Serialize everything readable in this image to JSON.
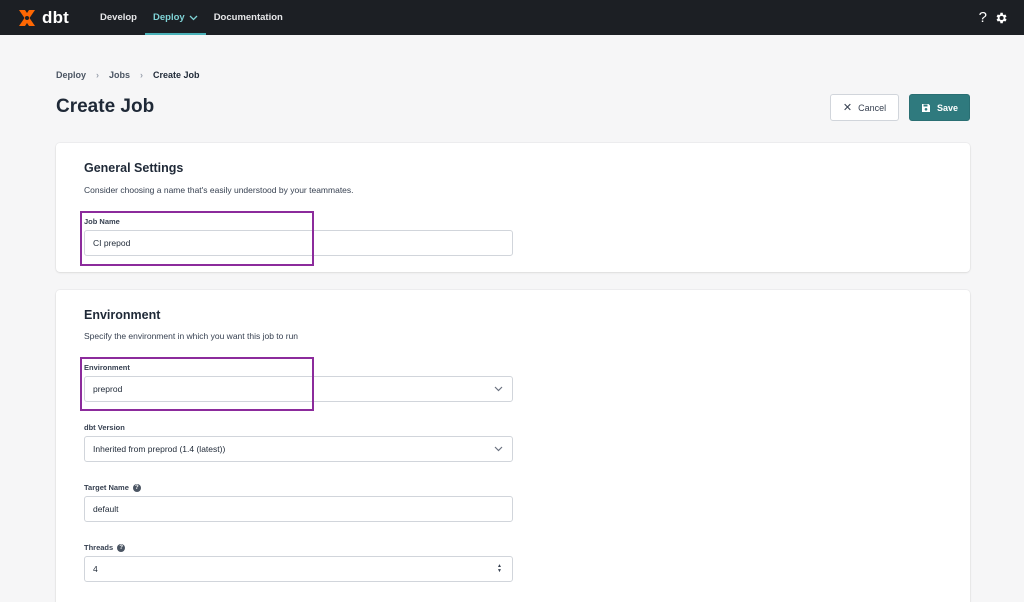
{
  "brand": {
    "name": "dbt",
    "logo_color": "#fe6703"
  },
  "nav": {
    "links": [
      {
        "label": "Develop",
        "active": false
      },
      {
        "label": "Deploy",
        "active": true,
        "has_dropdown": true
      },
      {
        "label": "Documentation",
        "active": false
      }
    ],
    "help_icon": "question-mark-icon",
    "settings_icon": "gear-icon"
  },
  "breadcrumb": {
    "items": [
      "Deploy",
      "Jobs",
      "Create Job"
    ],
    "separator": "›"
  },
  "page": {
    "title": "Create Job",
    "cancel_label": "Cancel",
    "save_label": "Save"
  },
  "general_settings": {
    "title": "General Settings",
    "description": "Consider choosing a name that's easily understood by your teammates.",
    "job_name_label": "Job Name",
    "job_name_value": "CI prepod"
  },
  "environment_section": {
    "title": "Environment",
    "description": "Specify the environment in which you want this job to run",
    "environment_label": "Environment",
    "environment_value": "preprod",
    "dbt_version_label": "dbt Version",
    "dbt_version_value": "Inherited from preprod (1.4 (latest))",
    "target_name_label": "Target Name",
    "target_name_value": "default",
    "threads_label": "Threads",
    "threads_value": "4"
  },
  "colors": {
    "nav_bg": "#1c1f24",
    "nav_active": "#7fd3d6",
    "primary_button": "#2f7a7e",
    "highlight_border": "#8c2b9c"
  }
}
